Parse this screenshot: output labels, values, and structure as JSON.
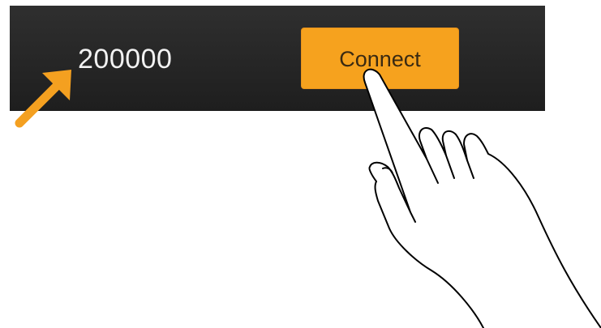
{
  "toolbar": {
    "value_text": "200000",
    "connect_label": "Connect"
  },
  "icons": {
    "arrow": "arrow-up-right-icon",
    "hand": "pointing-hand-icon"
  },
  "colors": {
    "bar_background": "#2a2a2a",
    "accent": "#f6a21e",
    "value_text": "#f2f2f2"
  }
}
